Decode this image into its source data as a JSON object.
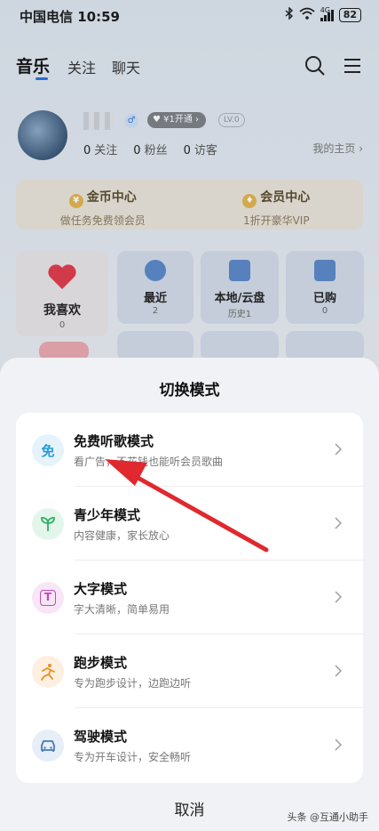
{
  "status_bar": {
    "carrier_time": "中国电信 10:59",
    "network": "4G",
    "battery": "82"
  },
  "nav": {
    "tabs": [
      {
        "label": "音乐",
        "active": true
      },
      {
        "label": "关注",
        "active": false
      },
      {
        "label": "聊天",
        "active": false
      }
    ],
    "search_icon": "search-icon",
    "menu_icon": "menu-icon"
  },
  "profile": {
    "vip_badge": "¥1开通",
    "level": "LV.0",
    "stats": [
      {
        "value": "0",
        "label": "关注"
      },
      {
        "value": "0",
        "label": "粉丝"
      },
      {
        "value": "0",
        "label": "访客"
      }
    ],
    "my_home": "我的主页 ›"
  },
  "cards": [
    {
      "title": "金币中心",
      "subtitle": "做任务免费领会员",
      "icon": "coin-icon"
    },
    {
      "title": "会员中心",
      "subtitle": "1折开豪华VIP",
      "icon": "diamond-icon"
    }
  ],
  "grid": [
    {
      "label": "我喜欢",
      "sub": "0",
      "icon": "heart-icon"
    },
    {
      "label": "最近",
      "sub": "2",
      "icon": "clock-icon"
    },
    {
      "label": "本地/云盘",
      "sub": "历史1",
      "icon": "download-icon"
    },
    {
      "label": "已购",
      "sub": "0",
      "icon": "bag-icon"
    }
  ],
  "sheet": {
    "title": "切换模式",
    "modes": [
      {
        "title": "免费听歌模式",
        "desc": "看广告，不花钱也能听会员歌曲",
        "icon": "free-icon",
        "color": "#e6f3fb",
        "glyph": "免",
        "glyph_color": "#2a9ad8"
      },
      {
        "title": "青少年模式",
        "desc": "内容健康，家长放心",
        "icon": "sprout-icon",
        "color": "#e4f6ec",
        "glyph_color": "#2fae62"
      },
      {
        "title": "大字模式",
        "desc": "字大清晰，简单易用",
        "icon": "text-size-icon",
        "color": "#f8e6f6",
        "glyph": "T",
        "glyph_color": "#c04bb5"
      },
      {
        "title": "跑步模式",
        "desc": "专为跑步设计，边跑边听",
        "icon": "running-icon",
        "color": "#fdf0e0",
        "glyph_color": "#ef8c21"
      },
      {
        "title": "驾驶模式",
        "desc": "专为开车设计，安全畅听",
        "icon": "car-icon",
        "color": "#e6eef8",
        "glyph_color": "#4a78b8"
      }
    ],
    "cancel": "取消"
  },
  "watermark": "头条 @互通小助手",
  "colors": {
    "accent": "#2b6fe0",
    "arrow": "#e0282e"
  }
}
